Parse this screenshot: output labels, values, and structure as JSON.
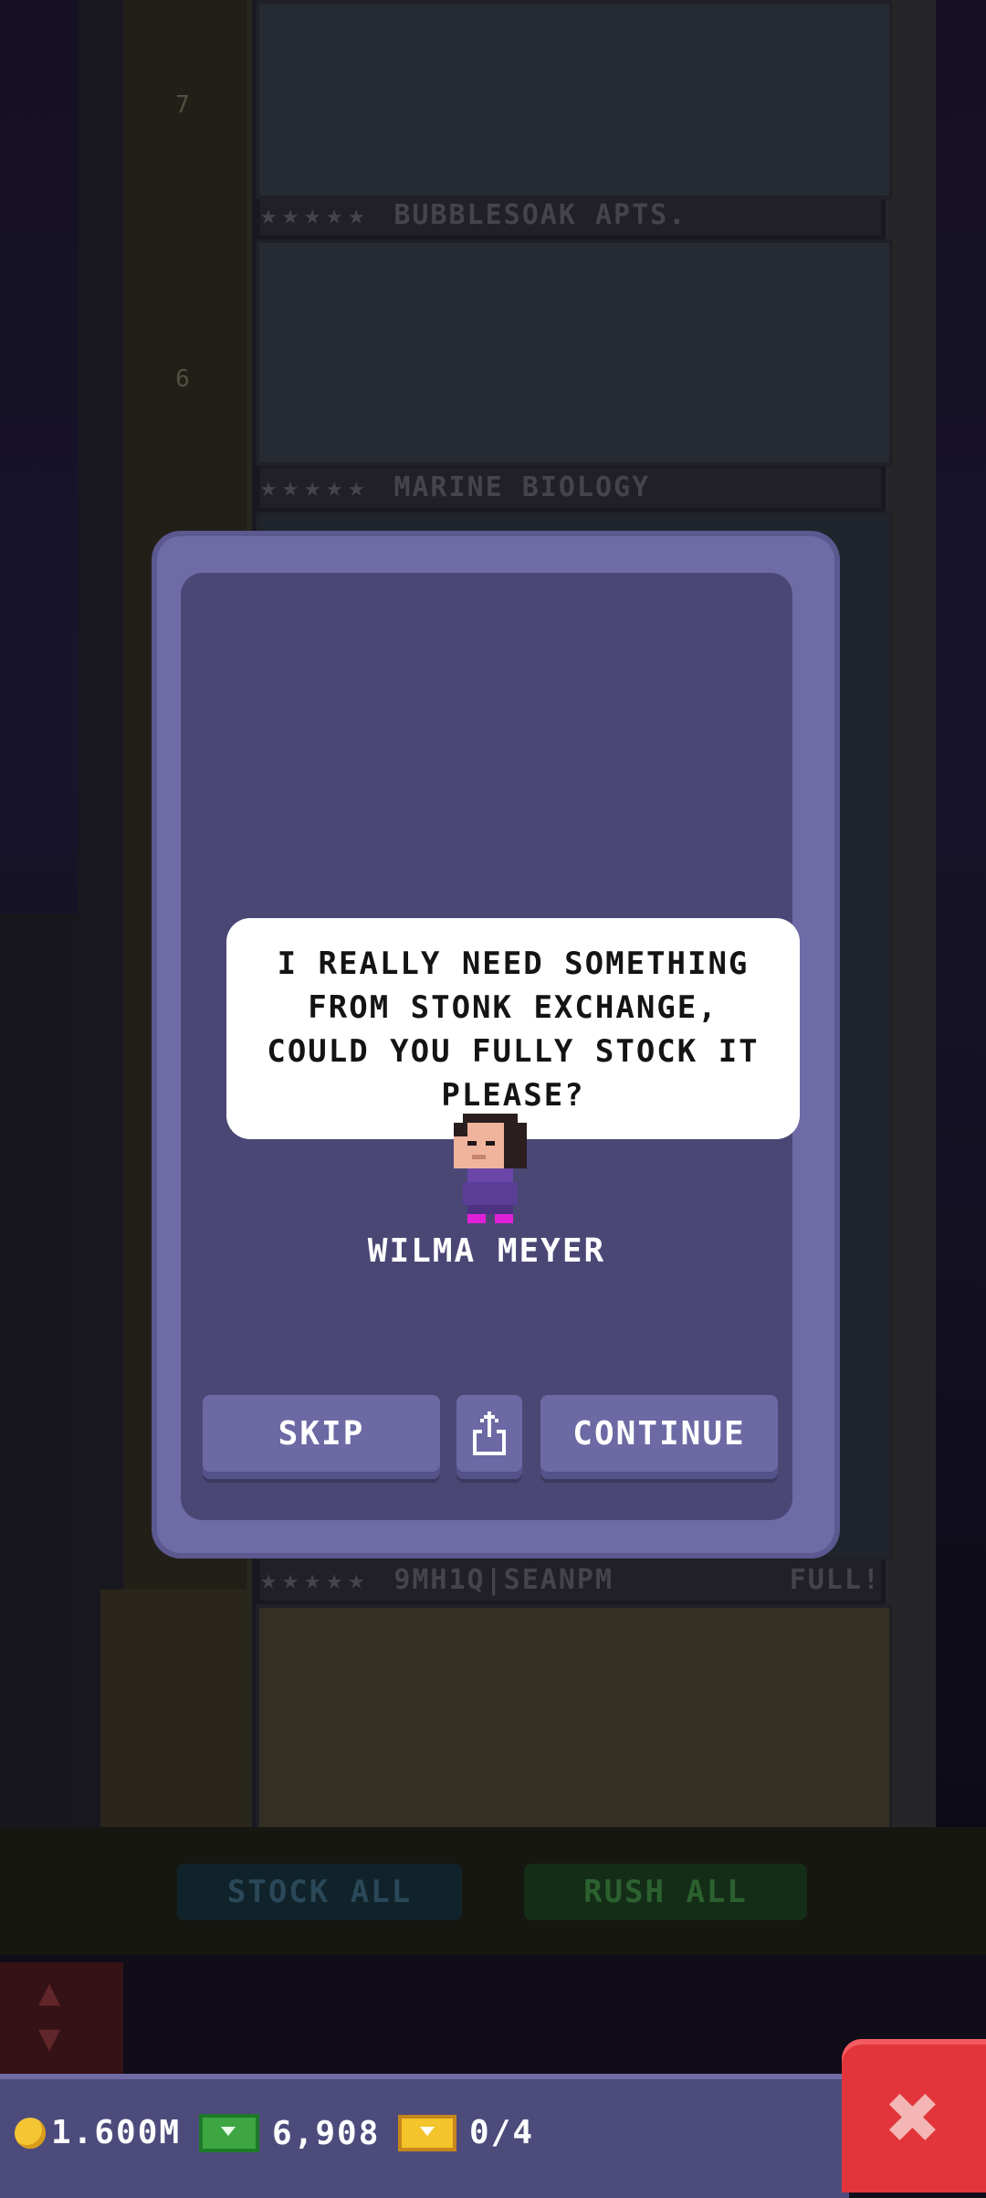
{
  "background": {
    "floors": [
      {
        "number": "7",
        "name": "BUBBLESOAK APTS.",
        "status": ""
      },
      {
        "number": "6",
        "name": "MARINE BIOLOGY",
        "status": ""
      },
      {
        "number": "",
        "name": "9MH1Q|SEANPM",
        "status": "FULL!"
      }
    ],
    "stars": "★★★★★",
    "stock_all_label": "STOCK ALL",
    "rush_all_label": "RUSH ALL"
  },
  "dialog": {
    "message": "I REALLY NEED SOMETHING FROM STONK EXCHANGE, COULD YOU FULLY STOCK IT PLEASE?",
    "npc_name": "WILMA MEYER",
    "skip_label": "SKIP",
    "continue_label": "CONTINUE",
    "share_icon": "share-icon"
  },
  "currency": {
    "coins": "1.600M",
    "bux": "6,908",
    "tickets": "0/4"
  },
  "colors": {
    "dialog_bg": "#4b4775",
    "dialog_frame": "#6f6ba6",
    "button": "#6c69a4",
    "close_button": "#e2353b",
    "bubble": "#ffffff"
  }
}
